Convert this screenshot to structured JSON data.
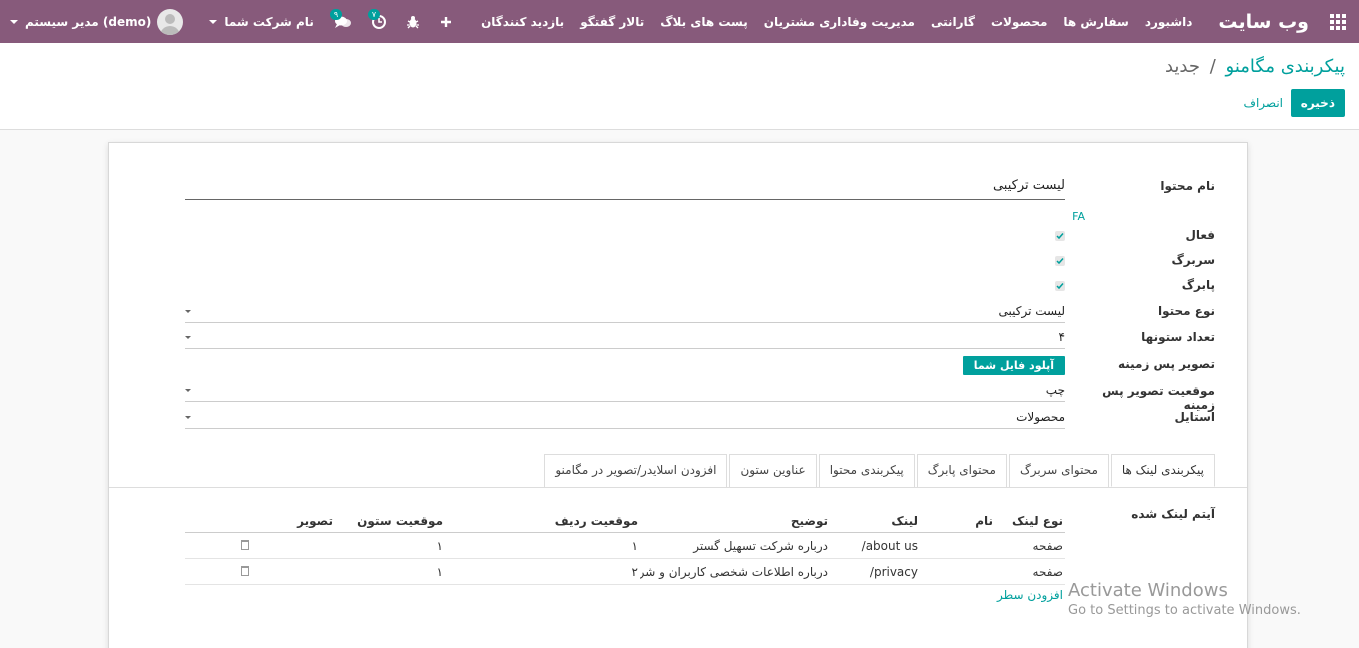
{
  "nav": {
    "brand": "وب سایت",
    "menu": [
      "داشبورد",
      "سفارش ها",
      "محصولات",
      "گارانتی",
      "مدیریت وفاداری مشتریان",
      "پست های بلاگ",
      "تالار گفتگو",
      "بازدید کنندگان"
    ],
    "user_name": "مدیر سیستم (demo)",
    "company_name": "نام شرکت شما",
    "messages_count": "۹",
    "activities_count": "۷"
  },
  "breadcrumb": {
    "parent": "پیکربندی مگامنو",
    "sep": "/",
    "current": "جدید"
  },
  "buttons": {
    "save": "ذخیره",
    "discard": "انصراف",
    "upload": "آپلود فایل شما",
    "add_line": "افزودن سطر"
  },
  "form": {
    "content_name_label": "نام محتوا",
    "content_name_value": "لیست ترکیبی",
    "lang": "FA",
    "active_label": "فعال",
    "header_label": "سربرگ",
    "footer_label": "پابرگ",
    "content_type_label": "نوع محتوا",
    "content_type_value": "لیست ترکیبی",
    "columns_label": "تعداد ستونها",
    "columns_value": "۴",
    "bg_image_label": "تصویر پس زمینه",
    "bg_position_label": "موقعیت تصویر پس زمینه",
    "bg_position_value": "چپ",
    "style_label": "استایل",
    "style_value": "محصولات"
  },
  "tabs": [
    "پیکربندی لینک ها",
    "محتوای سربرگ",
    "محتوای پابرگ",
    "پیکربندی محتوا",
    "عناوین ستون",
    "افزودن اسلایدر/تصویر در مگامنو"
  ],
  "linked_items_label": "آیتم لینک شده",
  "table": {
    "headers": [
      "نوع لینک",
      "نام",
      "لینک",
      "توضیح",
      "موقعیت ردیف",
      "موقعیت ستون",
      "تصویر"
    ],
    "rows": [
      [
        "صفحه",
        "",
        "/about us",
        "درباره شرکت تسهیل گستر",
        "۱",
        "۱",
        ""
      ],
      [
        "صفحه",
        "",
        "/privacy",
        "درباره اطلاعات شخصی کاربران و شرکت",
        "۲",
        "۱",
        ""
      ]
    ]
  },
  "watermark": {
    "title": "Activate Windows",
    "subtitle": "Go to Settings to activate Windows."
  }
}
